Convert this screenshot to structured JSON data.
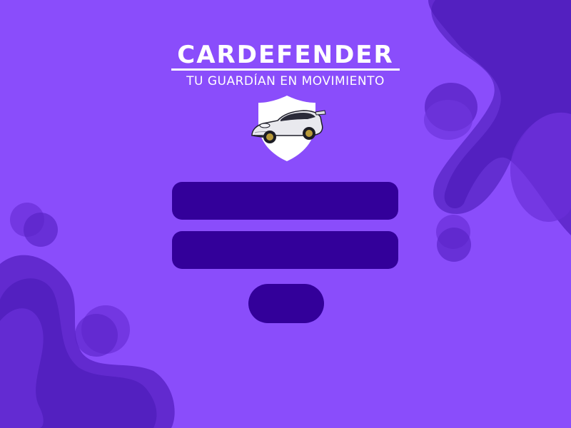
{
  "app": {
    "title": "CARDEFENDER",
    "tagline": "TU GUARDÍAN EN MOVIMIENTO"
  },
  "logo": {
    "shield_icon": "shield-icon",
    "car_icon": "sports-car-icon"
  },
  "form": {
    "username_value": "",
    "username_placeholder": "",
    "password_value": "",
    "password_placeholder": "",
    "submit_label": ""
  },
  "colors": {
    "background": "#8a4dfb",
    "blob_dark": "#5a24c7",
    "blob_mid": "#6e34dd",
    "field": "#33009a",
    "text": "#ffffff"
  }
}
